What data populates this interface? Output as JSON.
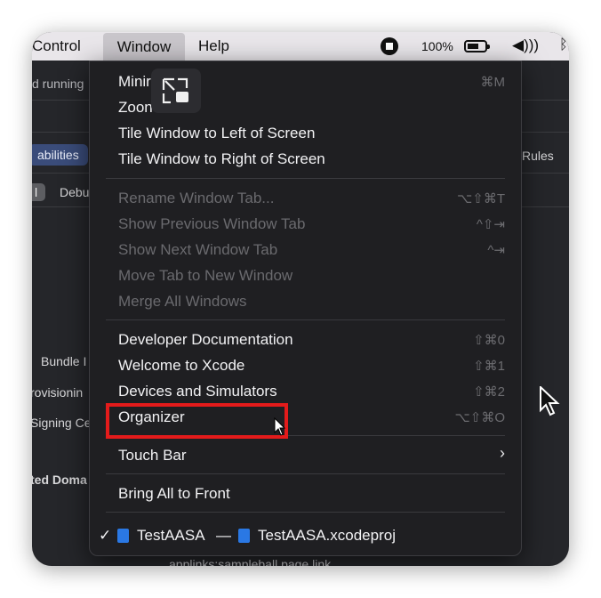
{
  "menubar": {
    "control": "Control",
    "window": "Window",
    "help": "Help",
    "battery_percent": "100%",
    "icons": [
      "stop-icon",
      "battery-charging-icon",
      "volume-icon",
      "bluetooth-icon"
    ]
  },
  "background": {
    "running_text": "d running",
    "capabilities_tab": "abilities",
    "all_chip": "l",
    "debug_chip": "Debu",
    "rules_tab": "Rules",
    "bundle_label": "Bundle I",
    "provisioning_label": "rovisionin",
    "signing_label": "Signing Ce",
    "domains_label": "ted Doma",
    "applinks_text": "applinks:sampleball.page.link"
  },
  "menu": {
    "minimize": {
      "label": "Minir",
      "shortcut": "⌘M"
    },
    "zoom": {
      "label": "Zoon"
    },
    "tile_left": {
      "label": "Tile Window to Left of Screen"
    },
    "tile_right": {
      "label": "Tile Window to Right of Screen"
    },
    "rename_tab": {
      "label": "Rename Window Tab...",
      "shortcut": "⌥⇧⌘T"
    },
    "prev_tab": {
      "label": "Show Previous Window Tab",
      "shortcut": "^⇧⇥"
    },
    "next_tab": {
      "label": "Show Next Window Tab",
      "shortcut": "^⇥"
    },
    "move_tab": {
      "label": "Move Tab to New Window"
    },
    "merge_all": {
      "label": "Merge All Windows"
    },
    "dev_docs": {
      "label": "Developer Documentation",
      "shortcut": "⇧⌘0"
    },
    "welcome": {
      "label": "Welcome to Xcode",
      "shortcut": "⇧⌘1"
    },
    "devices": {
      "label": "Devices and Simulators",
      "shortcut": "⇧⌘2"
    },
    "organizer": {
      "label": "Organizer",
      "shortcut": "⌥⇧⌘O"
    },
    "touch_bar": {
      "label": "Touch Bar",
      "chevron": "›"
    },
    "bring_front": {
      "label": "Bring All to Front"
    },
    "window_entry": {
      "check": "✓",
      "project": "TestAASA",
      "dash": "—",
      "file": "TestAASA.xcodeproj"
    }
  },
  "colors": {
    "highlight": "#e31b1b",
    "menu_bg": "#1f1f22",
    "menubar_bg": "#e9e6ea",
    "accent_blue": "#2a78e4"
  }
}
